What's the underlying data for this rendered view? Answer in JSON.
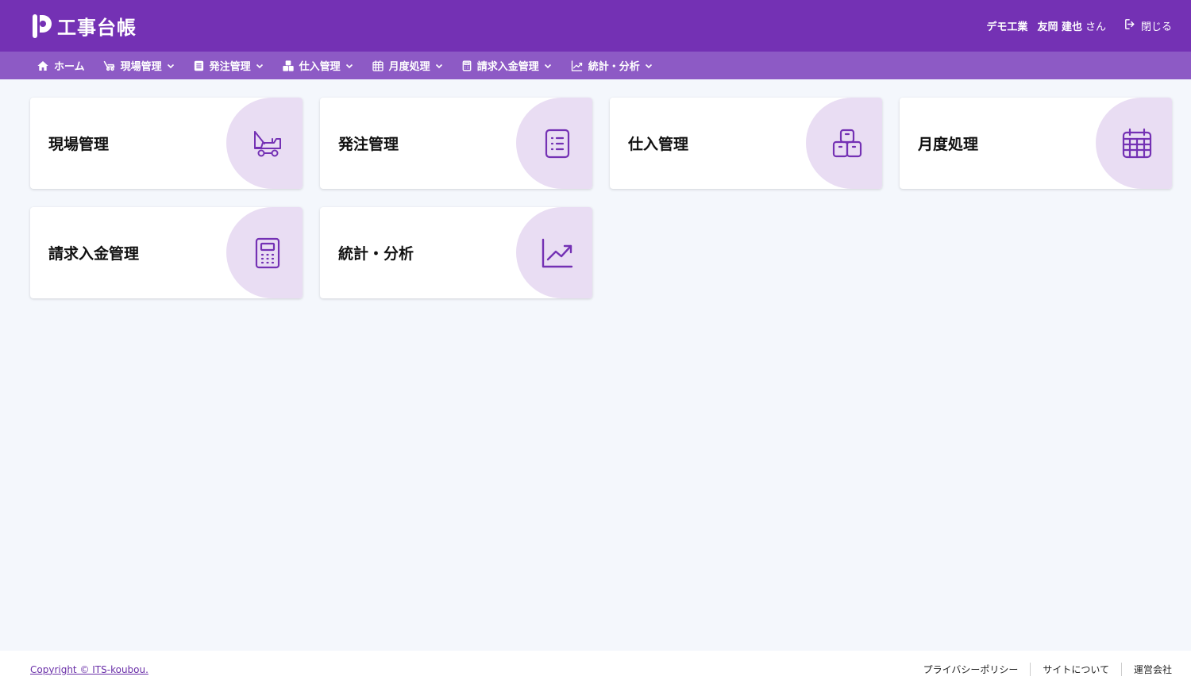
{
  "header": {
    "app_title": "工事台帳",
    "company": "デモ工業",
    "user_name": "友岡 建也",
    "user_suffix": "さん",
    "close_label": "閉じる"
  },
  "nav": {
    "items": [
      {
        "label": "ホーム",
        "icon": "home-icon"
      },
      {
        "label": "現場管理",
        "icon": "excavator-icon"
      },
      {
        "label": "発注管理",
        "icon": "list-icon"
      },
      {
        "label": "仕入管理",
        "icon": "boxes-icon"
      },
      {
        "label": "月度処理",
        "icon": "calendar-icon"
      },
      {
        "label": "請求入金管理",
        "icon": "calculator-icon"
      },
      {
        "label": "統計・分析",
        "icon": "chart-icon"
      }
    ]
  },
  "cards": [
    {
      "label": "現場管理",
      "icon": "excavator-icon"
    },
    {
      "label": "発注管理",
      "icon": "list-icon"
    },
    {
      "label": "仕入管理",
      "icon": "boxes-icon"
    },
    {
      "label": "月度処理",
      "icon": "calendar-icon"
    },
    {
      "label": "請求入金管理",
      "icon": "calculator-icon"
    },
    {
      "label": "統計・分析",
      "icon": "chart-icon"
    }
  ],
  "footer": {
    "copyright": "Copyright © ITS-koubou.",
    "links": [
      "プライバシーポリシー",
      "サイトについて",
      "運営会社"
    ]
  },
  "colors": {
    "header_bg": "#7431b4",
    "nav_bg": "#8d5ac5",
    "icon_accent": "#7431b4",
    "bubble_bg": "#e9ddf3"
  }
}
